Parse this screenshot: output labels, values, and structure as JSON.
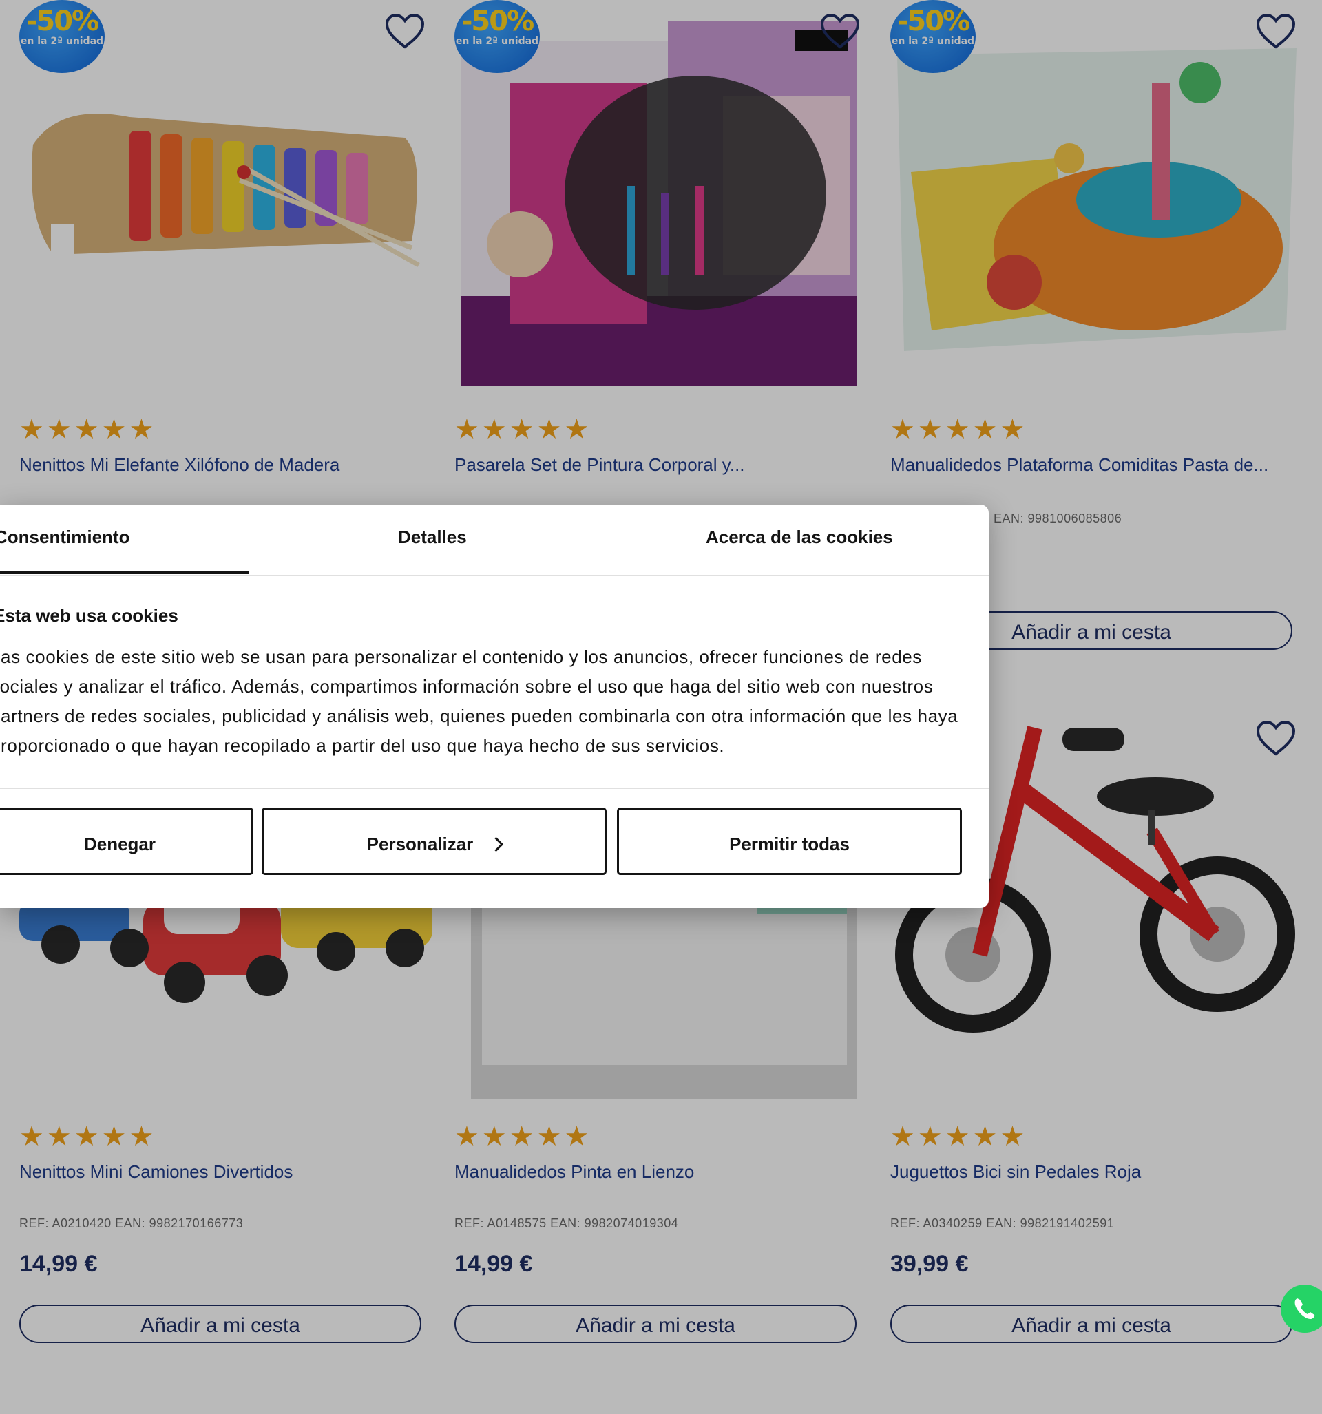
{
  "products": [
    {
      "name": "Nenittos Mi Elefante Xilófono de Madera",
      "ref": "",
      "price": "",
      "button": "",
      "badge": {
        "pct": "-50%",
        "sub": "en la 2ª unidad"
      },
      "rating": 5
    },
    {
      "name": "Pasarela Set de Pintura Corporal y...",
      "ref": "",
      "price": "",
      "button": "",
      "badge": {
        "pct": "-50%",
        "sub": "en la 2ª unidad"
      },
      "rating": 5
    },
    {
      "name": "Manualidedos Plataforma Comiditas Pasta de...",
      "ref": "EAN: 9981006085806",
      "price": "",
      "button": "Añadir a mi cesta",
      "badge": {
        "pct": "-50%",
        "sub": "en la 2ª unidad"
      },
      "rating": 5
    },
    {
      "name": "Nenittos Mini Camiones Divertidos",
      "ref": "REF: A0210420 EAN: 9982170166773",
      "price": "14,99 €",
      "button": "Añadir a mi cesta",
      "rating": 5
    },
    {
      "name": "Manualidedos Pinta en Lienzo",
      "ref": "REF: A0148575 EAN: 9982074019304",
      "price": "14,99 €",
      "button": "Añadir a mi cesta",
      "rating": 5
    },
    {
      "name": "Juguettos Bici sin Pedales Roja",
      "ref": "REF: A0340259 EAN: 9982191402591",
      "price": "39,99 €",
      "button": "Añadir a mi cesta",
      "rating": 5
    }
  ],
  "cookie": {
    "tabs": [
      "Consentimiento",
      "Detalles",
      "Acerca de las cookies"
    ],
    "title": "Esta web usa cookies",
    "body_lines": [
      "Las cookies de este sitio web se usan para personalizar el contenido y los anuncios, ofrecer funciones de redes",
      "sociales y analizar el tráfico. Además, compartimos información sobre el uso que haga del sitio web con nuestros",
      "partners de redes sociales, publicidad y análisis web, quienes pueden combinarla con otra información que les haya",
      "proporcionado o que hayan recopilado a partir del uso que haya hecho de sus servicios."
    ],
    "buttons": {
      "deny": "Denegar",
      "customize": "Personalizar",
      "allow_all": "Permitir todas"
    }
  },
  "colors": {
    "accent": "#1f2e63",
    "star": "#f2a21b",
    "badge": "#1f7fe8",
    "overlay": "rgba(0,0,0,0.27)"
  }
}
